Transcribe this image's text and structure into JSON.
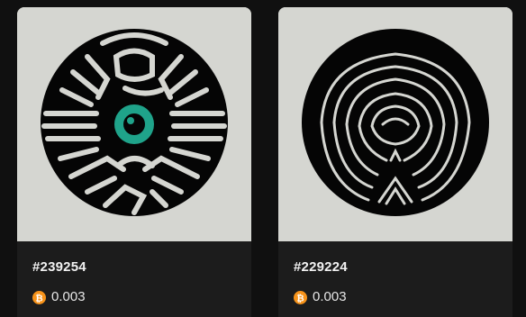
{
  "cards": [
    {
      "id_label": "#239254",
      "price": "0.003",
      "currency_icon": "bitcoin-icon",
      "art_description_icon": "maze-eye-art",
      "accent_color": "#1fa38a"
    },
    {
      "id_label": "#229224",
      "price": "0.003",
      "currency_icon": "bitcoin-icon",
      "art_description_icon": "concentric-rings-art",
      "accent_color": "#000000"
    }
  ],
  "colors": {
    "background": "#101010",
    "card": "#1c1c1c",
    "art_background": "#d5d6d1",
    "bitcoin": "#f7931a"
  }
}
